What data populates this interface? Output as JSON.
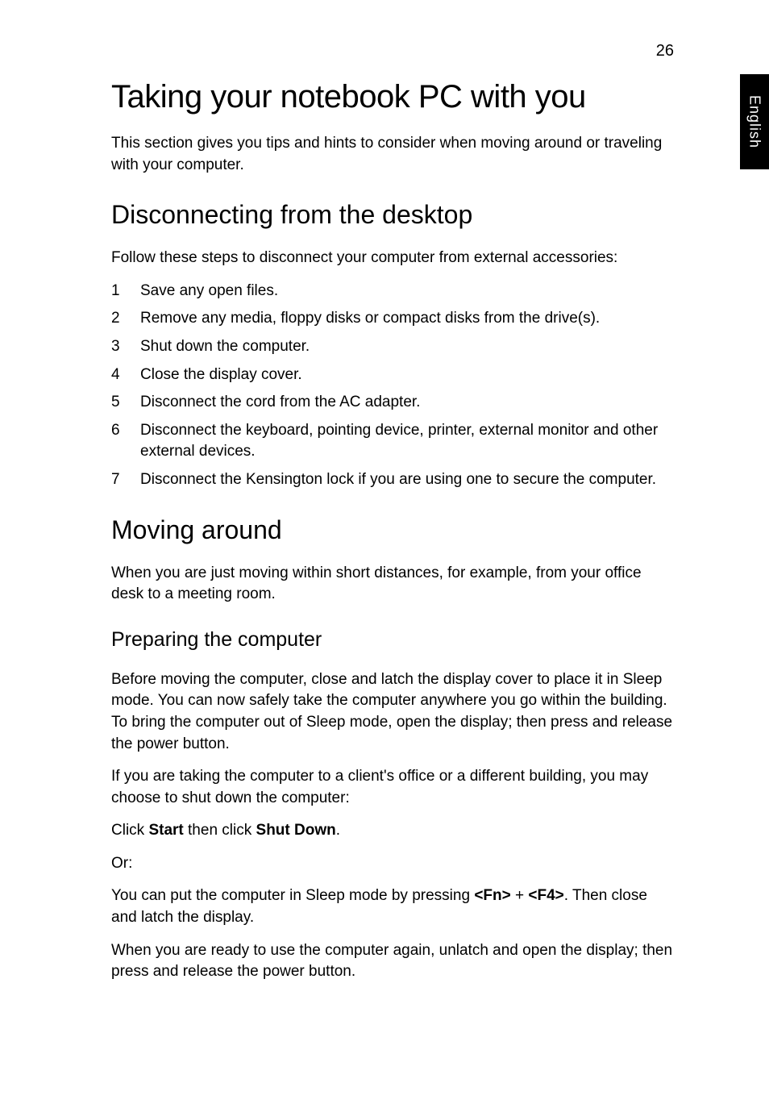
{
  "page_number": "26",
  "side_tab": "English",
  "h1": "Taking your notebook PC with you",
  "intro": "This section gives you tips and hints to consider when moving around or traveling with your computer.",
  "section1": {
    "heading": "Disconnecting from the desktop",
    "lead": "Follow these steps to disconnect your computer from external accessories:",
    "steps": [
      {
        "n": "1",
        "t": "Save any open files."
      },
      {
        "n": "2",
        "t": "Remove any media, floppy disks or compact disks from the drive(s)."
      },
      {
        "n": "3",
        "t": "Shut down the computer."
      },
      {
        "n": "4",
        "t": "Close the display cover."
      },
      {
        "n": "5",
        "t": "Disconnect the cord from the AC adapter."
      },
      {
        "n": "6",
        "t": "Disconnect the keyboard, pointing device, printer, external monitor and other external devices."
      },
      {
        "n": "7",
        "t": "Disconnect the Kensington lock if you are using one to secure the computer."
      }
    ]
  },
  "section2": {
    "heading": "Moving around",
    "lead": "When you are just moving within short distances, for example, from your office desk to a meeting room.",
    "sub_heading": "Preparing the computer",
    "p1": "Before moving the computer, close and latch the display cover to place it in Sleep mode. You can now safely take the computer anywhere you go within the building. To bring the computer out of Sleep mode, open the display; then press and release the power button.",
    "p2": "If you are taking the computer to a client's office or a different building, you may choose to shut down the computer:",
    "p3_pre": "Click ",
    "p3_b1": "Start",
    "p3_mid": " then click ",
    "p3_b2": "Shut Down",
    "p3_post": ".",
    "p4": "Or:",
    "p5_pre": "You can put the computer in Sleep mode by pressing ",
    "p5_b1": "<Fn>",
    "p5_mid": " + ",
    "p5_b2": "<F4>",
    "p5_post": ". Then close and latch the display.",
    "p6": "When you are ready to use the computer again, unlatch and open the display; then press and release the power button."
  }
}
